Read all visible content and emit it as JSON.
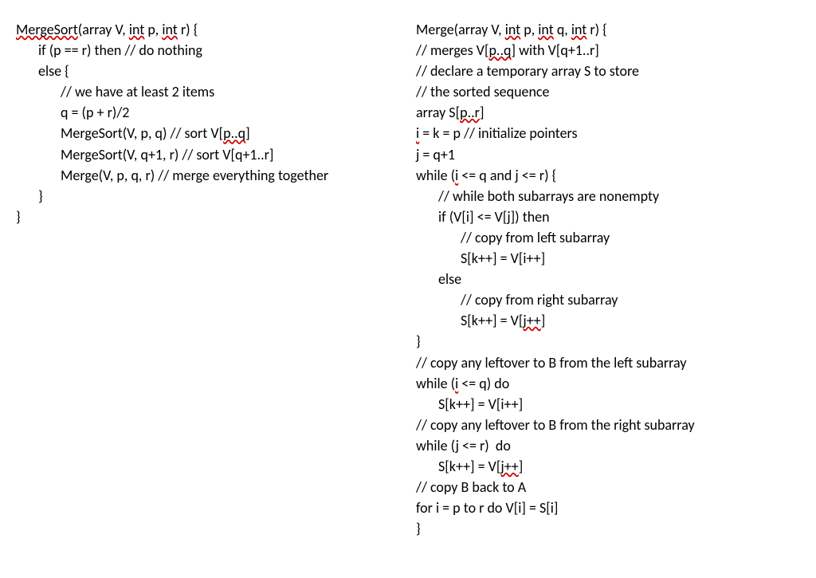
{
  "left": {
    "l0a": "MergeSort",
    "l0b": "(array V, ",
    "l0c": "int",
    "l0d": " p, ",
    "l0e": "int",
    "l0f": " r) {",
    "l1": "if (p == r) then // do nothing",
    "l2": "else {",
    "l3": "// we have at least 2 items",
    "l4": "q = (p + r)/2",
    "l5a": "MergeSort(V, p, q) // sort V[",
    "l5b": "p..q",
    "l5c": "]",
    "l6": "MergeSort(V, q+1, r) // sort V[q+1..r]",
    "l7": "Merge(V, p, q, r) // merge everything together",
    "l8": "}",
    "l9": "}"
  },
  "right": {
    "l0a": "Merge(array V, ",
    "l0b": "int",
    "l0c": " p, ",
    "l0d": "int",
    "l0e": " q, ",
    "l0f": "int",
    "l0g": " r) {",
    "l1a": "// merges V[",
    "l1b": "p..q",
    "l1c": "] with V[q+1..r]",
    "l2": "// declare a temporary array S to store",
    "l3": "// the sorted sequence",
    "l4a": "array S[",
    "l4b": "p..r",
    "l4c": "]",
    "l5a": "i",
    "l5b": " = k = p // initialize pointers",
    "l6": "j = q+1",
    "l7a": "while (",
    "l7b": "i",
    "l7c": " <= q and j <= r) {",
    "l8": "// while both subarrays are nonempty",
    "l9": "if (V[i] <= V[j]) then",
    "l10": "// copy from left subarray",
    "l11": "S[k++] = V[i++]",
    "l12": "else",
    "l13": "// copy from right subarray",
    "l14a": "S[k++] = V[",
    "l14b": "j++",
    "l14c": "]",
    "l15": "}",
    "l16": "// copy any leftover to B from the left subarray",
    "l17a": "while (",
    "l17b": "i",
    "l17c": " <= q) do",
    "l18": "S[k++] = V[i++]",
    "l19": "// copy any leftover to B from the right subarray",
    "l20": "while (j <= r)  do",
    "l21a": "S[k++] = V[",
    "l21b": "j++",
    "l21c": "]",
    "l22": "// copy B back to A",
    "l23": "for i = p to r do V[i] = S[i]",
    "l24": "}"
  }
}
